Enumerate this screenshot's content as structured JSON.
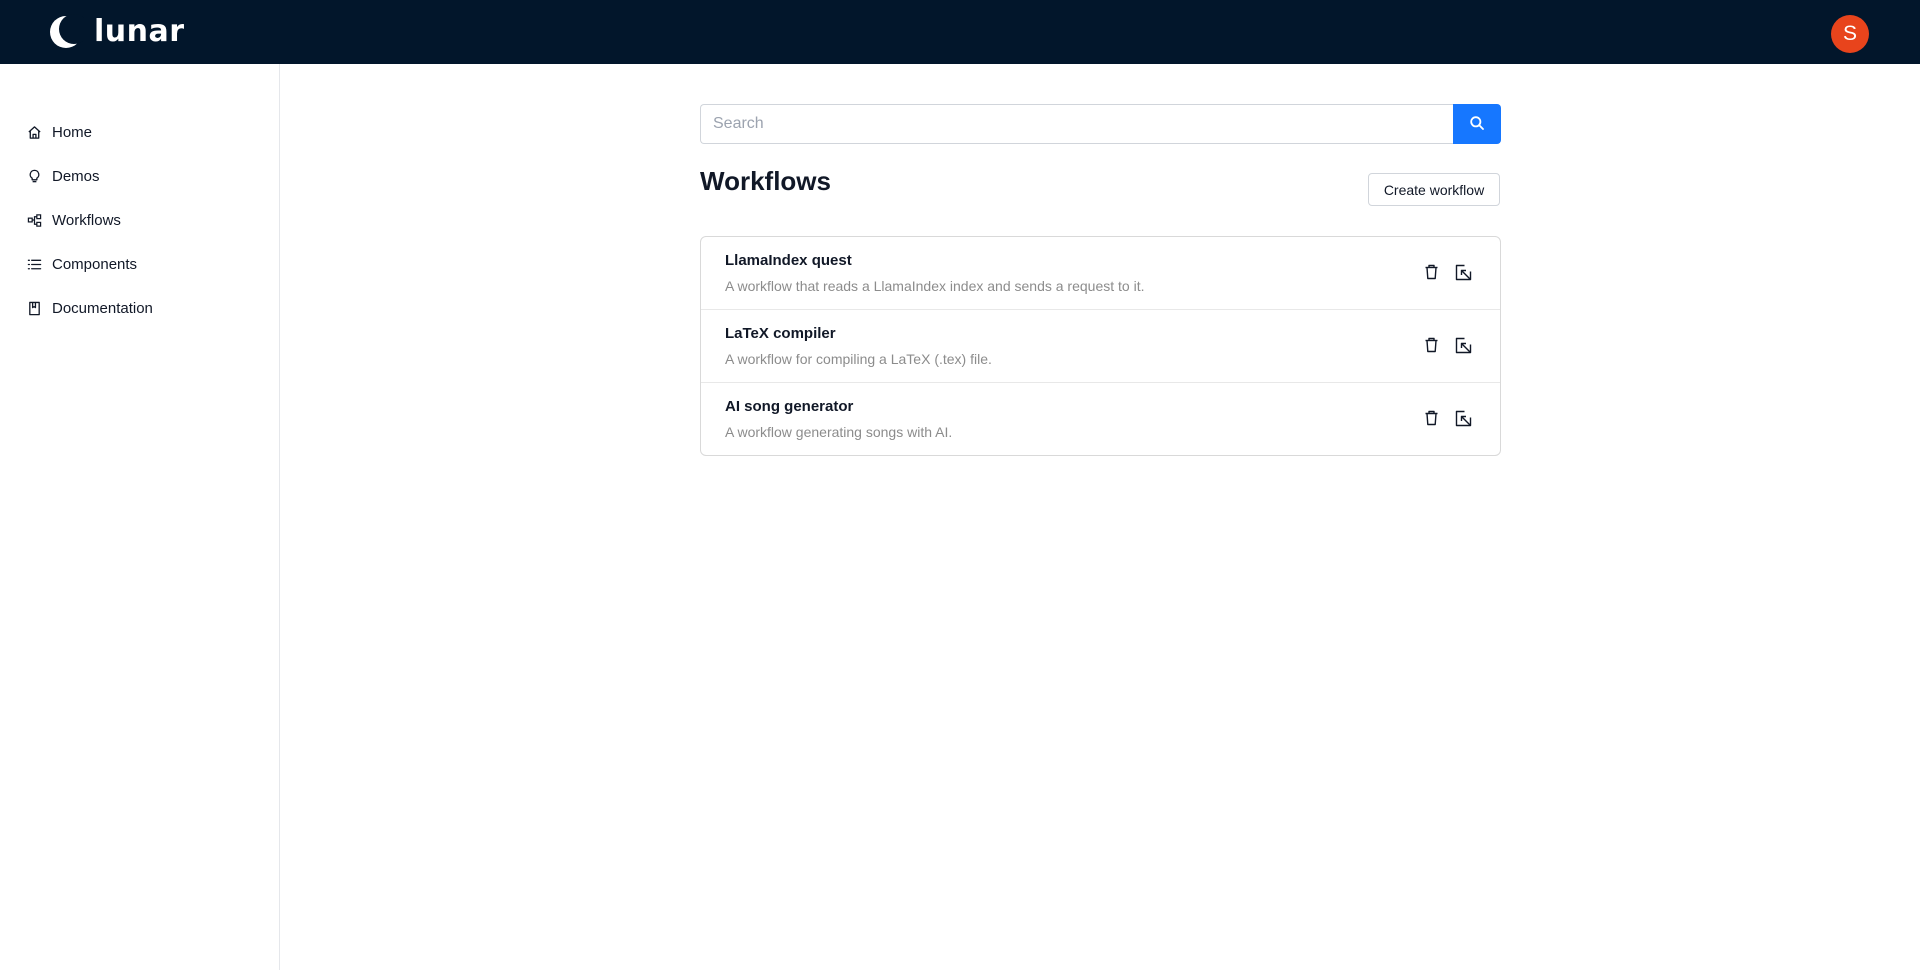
{
  "header": {
    "brand": "lunar",
    "avatar_initial": "S",
    "avatar_color": "#e8441c",
    "background_color": "#02162b"
  },
  "sidebar": {
    "items": [
      {
        "label": "Home",
        "icon": "home-icon"
      },
      {
        "label": "Demos",
        "icon": "lightbulb-icon"
      },
      {
        "label": "Workflows",
        "icon": "workflow-icon"
      },
      {
        "label": "Components",
        "icon": "list-icon"
      },
      {
        "label": "Documentation",
        "icon": "book-icon"
      }
    ]
  },
  "search": {
    "placeholder": "Search",
    "value": "",
    "button_icon": "search-icon",
    "button_color": "#1677ff"
  },
  "main": {
    "title": "Workflows",
    "create_label": "Create workflow"
  },
  "workflows": [
    {
      "title": "LlamaIndex quest",
      "description": "A workflow that reads a LlamaIndex index and sends a request to it."
    },
    {
      "title": "LaTeX compiler",
      "description": "A workflow for compiling a LaTeX (.tex) file."
    },
    {
      "title": "AI song generator",
      "description": "A workflow generating songs with AI."
    }
  ],
  "workflow_actions": [
    "delete-icon",
    "open-icon"
  ]
}
